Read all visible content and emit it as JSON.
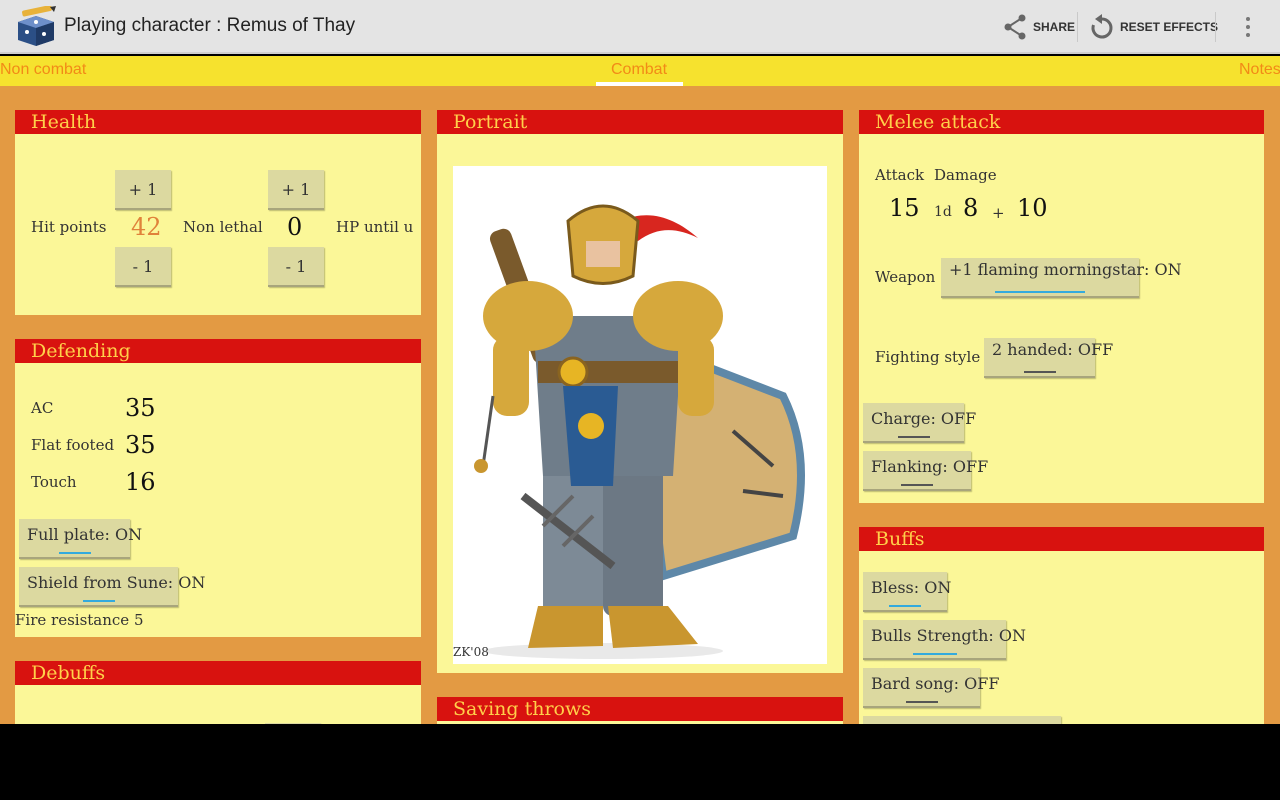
{
  "app": {
    "title": "Playing character : Remus of Thay",
    "icon": "dice-and-pencil-icon"
  },
  "actions": {
    "share": "SHARE",
    "reset": "RESET EFFECTS"
  },
  "tabs": [
    {
      "label": "Non combat",
      "selected": false
    },
    {
      "label": "Combat",
      "selected": true
    },
    {
      "label": "Notes",
      "selected": false
    }
  ],
  "health": {
    "title": "Health",
    "hp_label": "Hit points",
    "hp_value": "42",
    "hp_plus": "+ 1",
    "hp_minus": "- 1",
    "nonlethal_label": "Non lethal",
    "nonlethal_value": "0",
    "nonlethal_plus": "+ 1",
    "nonlethal_minus": "- 1",
    "hp_until_label": "HP until u"
  },
  "defending": {
    "title": "Defending",
    "ac_label": "AC",
    "ac_value": "35",
    "flat_label": "Flat footed",
    "flat_value": "35",
    "touch_label": "Touch",
    "touch_value": "16",
    "toggles": [
      "Full plate: ON",
      "Shield from Sune: ON"
    ],
    "note": "Fire resistance 5"
  },
  "debuffs": {
    "title": "Debuffs"
  },
  "portrait": {
    "title": "Portrait",
    "signature": "ZK'08"
  },
  "saving_throws": {
    "title": "Saving throws"
  },
  "melee": {
    "title": "Melee attack",
    "attack_label": "Attack",
    "damage_label": "Damage",
    "attack_value": "15",
    "dice_count": "1d",
    "dice_sides": "8",
    "plus_sign": "+",
    "damage_bonus": "10",
    "weapon_label": "Weapon",
    "weapon_value": "+1 flaming morningstar: ON",
    "style_label": "Fighting style",
    "style_value": "2 handed: OFF",
    "charge": "Charge: OFF",
    "flanking": "Flanking: OFF"
  },
  "buffs": {
    "title": "Buffs",
    "items": [
      "Bless: ON",
      "Bulls Strength: ON",
      "Bard song: OFF"
    ]
  },
  "colors": {
    "header_bg": "#d8120f",
    "header_text": "#ffd04a",
    "card_bg": "#fbf798",
    "page_bg": "#e39a43",
    "tab_bg": "#f6e22e",
    "tab_text": "#f28a17",
    "on_indicator": "#33aadd"
  }
}
